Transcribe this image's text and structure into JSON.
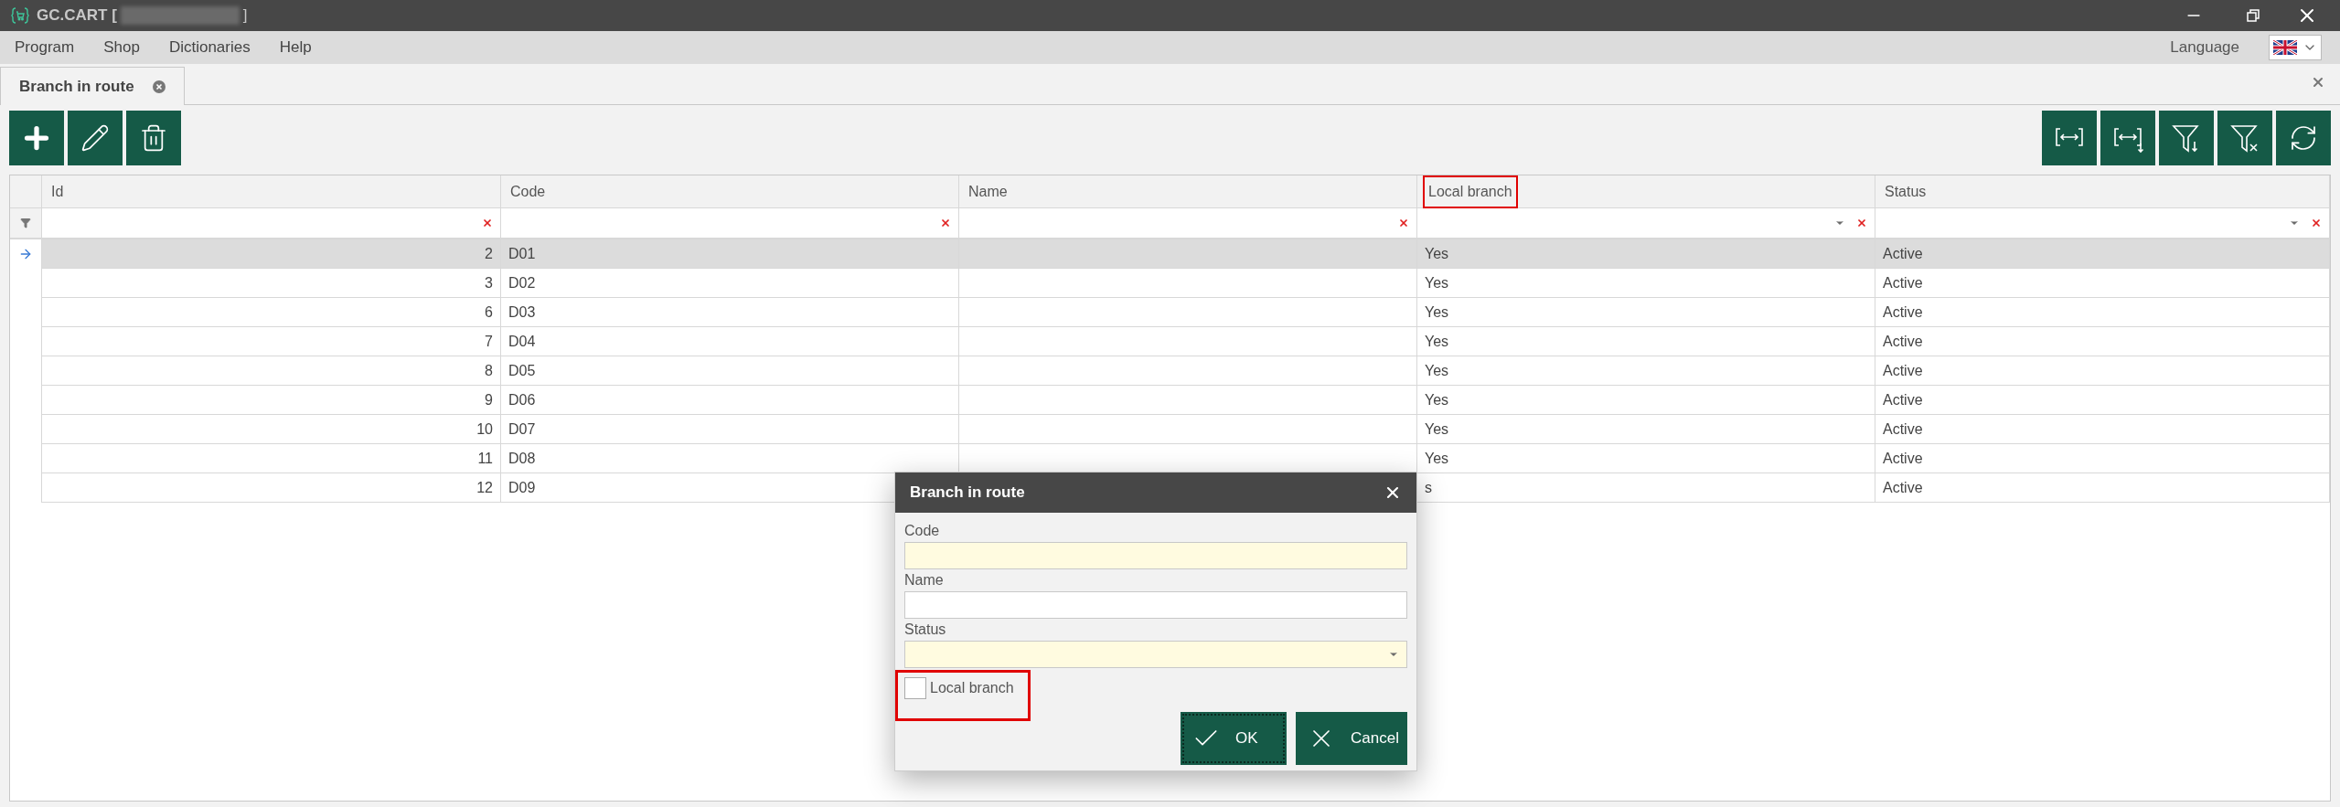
{
  "window": {
    "title": "GC.CART [",
    "title_end": "]"
  },
  "menu": [
    "Program",
    "Shop",
    "Dictionaries",
    "Help"
  ],
  "language": {
    "label": "Language"
  },
  "tabs": [
    {
      "label": "Branch in route",
      "selected": true
    }
  ],
  "toolbar_left": [
    {
      "kind": "add"
    },
    {
      "kind": "edit"
    },
    {
      "kind": "delete"
    }
  ],
  "toolbar_right": [
    {
      "kind": "fit"
    },
    {
      "kind": "fit-down"
    },
    {
      "kind": "filter-down"
    },
    {
      "kind": "filter-clear"
    },
    {
      "kind": "refresh"
    }
  ],
  "table": {
    "columns": [
      {
        "label": "Id",
        "filter_dropdown": false,
        "highlighted": false
      },
      {
        "label": "Code",
        "filter_dropdown": false,
        "highlighted": false
      },
      {
        "label": "Name",
        "filter_dropdown": false,
        "highlighted": false
      },
      {
        "label": "Local branch",
        "filter_dropdown": true,
        "highlighted": true
      },
      {
        "label": "Status",
        "filter_dropdown": true,
        "highlighted": false
      }
    ],
    "rows": [
      {
        "selected": true,
        "cells": [
          "2",
          "D01",
          "",
          "Yes",
          "Active"
        ]
      },
      {
        "selected": false,
        "cells": [
          "3",
          "D02",
          "",
          "Yes",
          "Active"
        ]
      },
      {
        "selected": false,
        "cells": [
          "6",
          "D03",
          "",
          "Yes",
          "Active"
        ]
      },
      {
        "selected": false,
        "cells": [
          "7",
          "D04",
          "",
          "Yes",
          "Active"
        ]
      },
      {
        "selected": false,
        "cells": [
          "8",
          "D05",
          "",
          "Yes",
          "Active"
        ]
      },
      {
        "selected": false,
        "cells": [
          "9",
          "D06",
          "",
          "Yes",
          "Active"
        ]
      },
      {
        "selected": false,
        "cells": [
          "10",
          "D07",
          "",
          "Yes",
          "Active"
        ]
      },
      {
        "selected": false,
        "cells": [
          "11",
          "D08",
          "",
          "Yes",
          "Active"
        ]
      },
      {
        "selected": false,
        "cells": [
          "12",
          "D09",
          "",
          "s",
          "Active"
        ]
      }
    ]
  },
  "dialog": {
    "title": "Branch in route",
    "fields": [
      {
        "label": "Code",
        "kind": "text",
        "required": true
      },
      {
        "label": "Name",
        "kind": "text",
        "required": false
      },
      {
        "label": "Status",
        "kind": "dropdown",
        "required": true
      }
    ],
    "checkbox": {
      "label": "Local branch",
      "checked": false,
      "highlighted": true
    },
    "buttons": [
      {
        "label": "OK",
        "kind": "ok",
        "focused": true
      },
      {
        "label": "Cancel",
        "kind": "cancel",
        "focused": false
      }
    ]
  }
}
